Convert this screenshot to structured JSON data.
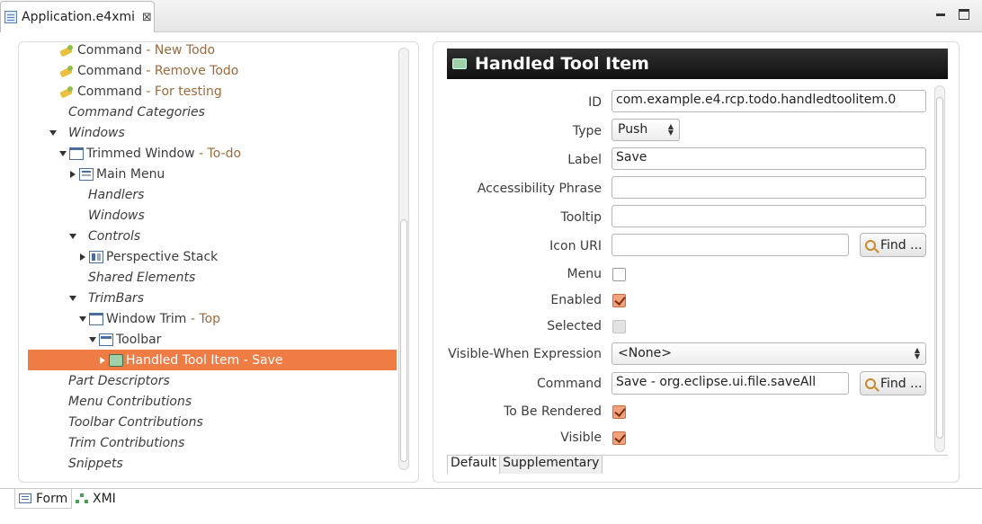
{
  "editor_tab": {
    "title": "Application.e4xmi",
    "close": "⊠"
  },
  "tree": {
    "rows": [
      {
        "indent": 0,
        "twisty": "none",
        "icon": "command",
        "label": "Command",
        "sub": " - New Todo",
        "italic": false,
        "selected": false
      },
      {
        "indent": 0,
        "twisty": "none",
        "icon": "command",
        "label": "Command",
        "sub": " - Remove Todo",
        "italic": false,
        "selected": false
      },
      {
        "indent": 0,
        "twisty": "none",
        "icon": "command",
        "label": "Command",
        "sub": " - For testing",
        "italic": false,
        "selected": false
      },
      {
        "indent": 0,
        "twisty": "none",
        "icon": "none",
        "label": "Command Categories",
        "sub": "",
        "italic": true,
        "selected": false
      },
      {
        "indent": 0,
        "twisty": "open",
        "icon": "none",
        "label": "Windows",
        "sub": "",
        "italic": true,
        "selected": false
      },
      {
        "indent": 1,
        "twisty": "open",
        "icon": "window",
        "label": "Trimmed Window",
        "sub": " - To-do",
        "italic": false,
        "selected": false
      },
      {
        "indent": 2,
        "twisty": "closed",
        "icon": "menu",
        "label": "Main Menu",
        "sub": "",
        "italic": false,
        "selected": false
      },
      {
        "indent": 2,
        "twisty": "none",
        "icon": "none",
        "label": "Handlers",
        "sub": "",
        "italic": true,
        "selected": false
      },
      {
        "indent": 2,
        "twisty": "none",
        "icon": "none",
        "label": "Windows",
        "sub": "",
        "italic": true,
        "selected": false
      },
      {
        "indent": 2,
        "twisty": "open",
        "icon": "none",
        "label": "Controls",
        "sub": "",
        "italic": true,
        "selected": false
      },
      {
        "indent": 3,
        "twisty": "closed",
        "icon": "stack",
        "label": "Perspective Stack",
        "sub": "",
        "italic": false,
        "selected": false
      },
      {
        "indent": 2,
        "twisty": "none",
        "icon": "none",
        "label": "Shared Elements",
        "sub": "",
        "italic": true,
        "selected": false
      },
      {
        "indent": 2,
        "twisty": "open",
        "icon": "none",
        "label": "TrimBars",
        "sub": "",
        "italic": true,
        "selected": false
      },
      {
        "indent": 3,
        "twisty": "open",
        "icon": "window",
        "label": "Window Trim",
        "sub": " - Top",
        "italic": false,
        "selected": false
      },
      {
        "indent": 4,
        "twisty": "open",
        "icon": "toolbar",
        "label": "Toolbar",
        "sub": "",
        "italic": false,
        "selected": false
      },
      {
        "indent": 5,
        "twisty": "closed",
        "icon": "toolitem",
        "label": "Handled Tool Item",
        "sub": " - Save",
        "italic": false,
        "selected": true
      },
      {
        "indent": 0,
        "twisty": "none",
        "icon": "none",
        "label": "Part Descriptors",
        "sub": "",
        "italic": true,
        "selected": false
      },
      {
        "indent": 0,
        "twisty": "none",
        "icon": "none",
        "label": "Menu Contributions",
        "sub": "",
        "italic": true,
        "selected": false
      },
      {
        "indent": 0,
        "twisty": "none",
        "icon": "none",
        "label": "Toolbar Contributions",
        "sub": "",
        "italic": true,
        "selected": false
      },
      {
        "indent": 0,
        "twisty": "none",
        "icon": "none",
        "label": "Trim Contributions",
        "sub": "",
        "italic": true,
        "selected": false
      },
      {
        "indent": 0,
        "twisty": "none",
        "icon": "none",
        "label": "Snippets",
        "sub": "",
        "italic": true,
        "selected": false
      }
    ]
  },
  "detail": {
    "title": "Handled Tool Item",
    "fields": {
      "id": {
        "label": "ID",
        "value": "com.example.e4.rcp.todo.handledtoolitem.0"
      },
      "type": {
        "label": "Type",
        "value": "Push"
      },
      "label": {
        "label": "Label",
        "value": "Save"
      },
      "accessibility": {
        "label": "Accessibility Phrase",
        "value": ""
      },
      "tooltip": {
        "label": "Tooltip",
        "value": ""
      },
      "icon_uri": {
        "label": "Icon URI",
        "value": "",
        "find": "Find ..."
      },
      "menu": {
        "label": "Menu",
        "checked": false
      },
      "enabled": {
        "label": "Enabled",
        "checked": true
      },
      "selected": {
        "label": "Selected",
        "checked": false
      },
      "visible_when": {
        "label": "Visible-When Expression",
        "value": "<None>"
      },
      "command": {
        "label": "Command",
        "value": "Save - org.eclipse.ui.file.saveAll",
        "find": "Find ..."
      },
      "to_be_rendered": {
        "label": "To Be Rendered",
        "checked": true
      },
      "visible": {
        "label": "Visible",
        "checked": true
      }
    },
    "subtabs": [
      "Default",
      "Supplementary"
    ]
  },
  "bottom_tabs": [
    "Form",
    "XMI"
  ],
  "colors": {
    "selection": "#f07c45",
    "subtext": "#9b6a3c",
    "header_bg": "#1c1c1c"
  }
}
